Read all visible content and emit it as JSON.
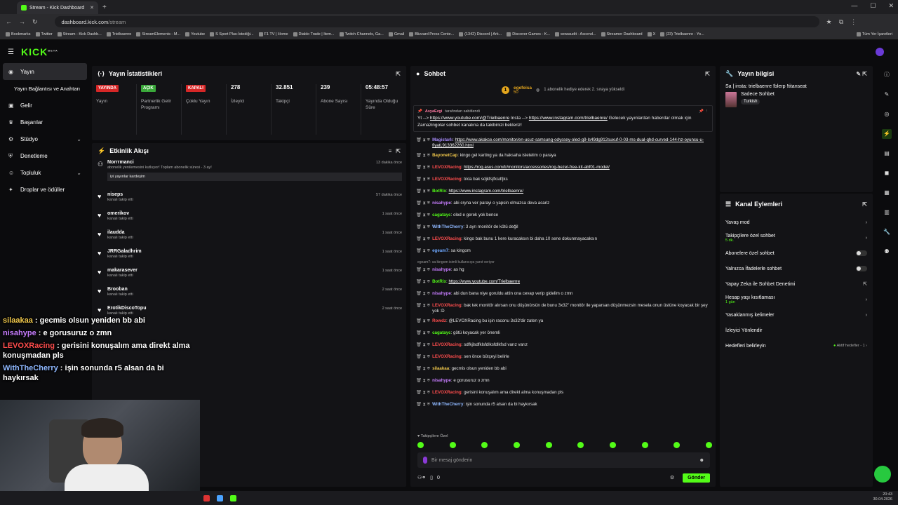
{
  "browser": {
    "tab_title": "Stream - Kick Dashboard",
    "url": "dashboard.kick.com",
    "url_path": "/stream",
    "bookmarks": [
      "Bookmarks",
      "Twitter",
      "Stream - Kick Dashb...",
      "Trielbaenre",
      "StreamElements - M...",
      "Youtube",
      "S Sport Plus-İstediği...",
      "F1 TV | Home",
      "Diablo Trade | Item...",
      "Twitch Channels, Ga...",
      "Gmail",
      "Blizzard Press Cente...",
      "(1342) Discord | Ark...",
      "Discover Games - K...",
      "wowaudit - Ascend...",
      "Streamer Dashboard",
      "X",
      "(23) Trielbaenre - Yo..."
    ],
    "all_bookmarks": "Tüm Yer İşaretleri"
  },
  "header": {
    "logo": "KICK",
    "logo_sup": "BETA"
  },
  "sidebar": {
    "items": [
      {
        "label": "Yayın"
      },
      {
        "label": "Yayın Bağlantısı ve Anahtarı"
      },
      {
        "label": "Gelir"
      },
      {
        "label": "Başarılar"
      },
      {
        "label": "Stüdyo"
      },
      {
        "label": "Denetleme"
      },
      {
        "label": "Topluluk"
      },
      {
        "label": "Droplar ve ödüller"
      }
    ]
  },
  "stats": {
    "title": "Yayın İstatistikleri",
    "items": [
      {
        "badge": "YAYINDA",
        "color": "#d62727",
        "label": "Yayın"
      },
      {
        "badge": "AÇIK",
        "color": "#3aa83a",
        "label": "Partnerlik Gelir Programı"
      },
      {
        "badge": "KAPALI",
        "color": "#d62727",
        "label": "Çoklu Yayın"
      },
      {
        "value": "278",
        "label": "İzleyici"
      },
      {
        "value": "32.851",
        "label": "Takipçi"
      },
      {
        "value": "239",
        "label": "Abone Sayısı"
      },
      {
        "value": "05:48:57",
        "label": "Yayında Olduğu Süre"
      }
    ]
  },
  "events": {
    "title": "Etkinlik Akışı",
    "items": [
      {
        "name": "Norrrmanci",
        "action": "abonelik yenilemesini kutluyor! Toplam abonelik süresi - 3 ay!",
        "time": "13 dakika önce",
        "msg": "iyi yayınlar kardeşim"
      },
      {
        "name": "niseps",
        "action": "kanalı takip etti",
        "time": "57 dakika önce"
      },
      {
        "name": "omerikov",
        "action": "kanalı takip etti",
        "time": "1 saat önce"
      },
      {
        "name": "ilaudda",
        "action": "kanalı takip etti",
        "time": "1 saat önce"
      },
      {
        "name": "JRRGaladhrim",
        "action": "kanalı takip etti",
        "time": "1 saat önce"
      },
      {
        "name": "makarasever",
        "action": "kanalı takip etti",
        "time": "1 saat önce"
      },
      {
        "name": "Brooban",
        "action": "kanalı takip etti",
        "time": "2 saat önce"
      },
      {
        "name": "ErotikDiscoTopu",
        "action": "kanalı takip etti",
        "time": "2 saat önce"
      }
    ]
  },
  "overlay": {
    "messages": [
      {
        "user": "silaakaa",
        "text": "gecmis olsun yeniden bb abi",
        "color": "#f2c94c"
      },
      {
        "user": "nisahype",
        "text": "e gorusuruz o zmn",
        "color": "#c77dff"
      },
      {
        "user": "LEVOXRacing",
        "text": "gerisini konuşalım ama direkt alma konuşmadan pls",
        "color": "#ff4d4d"
      },
      {
        "user": "WithTheCherry",
        "text": "işin sonunda r5 alsan da bi haykırsak",
        "color": "#8fb8ff"
      }
    ]
  },
  "chat": {
    "title": "Sohbet",
    "sub_user": "egefeisa",
    "sub_count": "50",
    "sub_text": "1 abonelik hediye ederek 2. sıraya yükseldi",
    "pinned_by": "AsyaEzgi",
    "pinned_label": "tarafından sabitlendi",
    "pinned_text_a": "Yt -->",
    "pinned_link1": "https://www.youtube.com/@Trielbaenre",
    "pinned_text_b": "Insta -->",
    "pinned_link2": "https://www.instagram.com/trielbaenre/",
    "pinned_text_c": "Gelecek yayınlardan haberdar olmak için Zamazingolar sohbet kanalına da takibinizi bekleriz!",
    "messages": [
      {
        "user": "Magistarlı",
        "color": "#a78bfa",
        "text": "",
        "link": "https://www.akakce.com/monitor/en-ucuz-samsung-odyssey-oled-g9-ls49dg912suxuf-0-03-ms-dual-qhd-curved-144-hz-oyuncu-u-fiyati,913362260.html",
        "wrap": true
      },
      {
        "user": "BayonetCap",
        "color": "#f2c94c",
        "text": "kingo gel karting ya da haksaha isletelim o paraya"
      },
      {
        "user": "LEVOXRacing",
        "color": "#ff4d4d",
        "text": "",
        "link": "https://rog.asus.com/tr/monitors/accessories/rog-bezel-free-kit-abf01-model/"
      },
      {
        "user": "LEVOXRacing",
        "color": "#ff4d4d",
        "text": "tıkla bak sdjkfsjfksdfjks"
      },
      {
        "user": "BotRix",
        "color": "#53fc18",
        "text": "",
        "link": "https://www.instagram.com/trielbaenre/"
      },
      {
        "user": "nisahype",
        "color": "#c77dff",
        "text": "abi cryna ver parayi o yapsin olmazsa deva acariz"
      },
      {
        "user": "cagatayc",
        "color": "#53fc18",
        "text": "oled e gerek yok bence"
      },
      {
        "user": "WithTheCherry",
        "color": "#8fb8ff",
        "text": "3 ayrı monitör de kötü değil"
      },
      {
        "user": "LEVOXRacing",
        "color": "#ff4d4d",
        "text": "kingo bak bunu 1 kere kuracaksın bi daha 10 sene dokunmayacaksın"
      },
      {
        "user": "egeam7",
        "color": "#6ea8ff",
        "text": "sa kingom"
      },
      {
        "reply": "egeam7: sa kingom isimli kullanıcıya yanıt veriyor"
      },
      {
        "user": "nisahype",
        "color": "#c77dff",
        "text": "as hg"
      },
      {
        "user": "BotRix",
        "color": "#53fc18",
        "text": "",
        "link": "https://www.youtube.com/Trielbaenre"
      },
      {
        "user": "nisahype",
        "color": "#c77dff",
        "text": "abi dun bana niye goruldu attin ona cevap verip gidelim o zmn"
      },
      {
        "user": "LEVOXRacing",
        "color": "#ff4d4d",
        "text": "bak tek monitör alırsan onu düşünürsün de bunu 3x32\" monitör ile yaparsan düşünmezsin mesela onun üstüne koyacak bir şey yok :D",
        "wrap": true
      },
      {
        "user": "Rowdz",
        "color": "#ff4d4d",
        "text": "@LEVOXRacing bu işin raconu 3x32'dir zaten ya"
      },
      {
        "user": "cagatayc",
        "color": "#53fc18",
        "text": "götü koyacak yer önemli"
      },
      {
        "user": "LEVOXRacing",
        "color": "#ff4d4d",
        "text": "sdfkjlsdfklsfdlksfdlkfsd varız varız"
      },
      {
        "user": "LEVOXRacing",
        "color": "#ff4d4d",
        "text": "sen önce bütçeyi belirle"
      },
      {
        "user": "silaakaa",
        "color": "#f2c94c",
        "text": "gecmis olsun yeniden bb abi"
      },
      {
        "user": "nisahype",
        "color": "#c77dff",
        "text": "e gorusuruz o zmn"
      },
      {
        "user": "LEVOXRacing",
        "color": "#ff4d4d",
        "text": "gerisini konuşalım ama direkt alma konuşmadan pls"
      },
      {
        "user": "WithTheCherry",
        "color": "#8fb8ff",
        "text": "işin sonunda r5 alsan da bi haykırsak"
      }
    ],
    "follow_label": "Takipçilere Özel",
    "input_placeholder": "Bir mesaj gönderin",
    "points": "0",
    "send_label": "Gönder"
  },
  "stream_info": {
    "title": "Yayın bilgisi",
    "stream_title": "Sa | insta: trielbaenre !blerp !titanseat",
    "category": "Sadece Sohbet",
    "tag": "Turkish"
  },
  "actions": {
    "title": "Kanal Eylemleri",
    "items": [
      {
        "label": "Yavaş mod",
        "type": "arrow"
      },
      {
        "label": "Takipçilere özel sohbet",
        "sub": "5 dk.",
        "type": "arrow"
      },
      {
        "label": "Abonelere özel sohbet",
        "type": "toggle"
      },
      {
        "label": "Yalnızca İfadelerle sohbet",
        "type": "toggle"
      },
      {
        "label": "Yapay Zeka ile Sohbet Denetimi",
        "type": "ext"
      },
      {
        "label": "Hesap yaşı kısıtlaması",
        "sub": "1 gün",
        "type": "arrow"
      },
      {
        "label": "Yasaklanmış kelimeler",
        "type": "arrow"
      },
      {
        "label": "İzleyici Yönlendir",
        "type": "none"
      },
      {
        "label": "Hedefleri belirleyin",
        "type": "goal",
        "goal_text": "Aktif hedefler - 1"
      }
    ]
  },
  "taskbar": {
    "time": "20:43",
    "date": "30.04.2026"
  },
  "colors": {
    "accent": "#53fc18",
    "live": "#d62727"
  }
}
